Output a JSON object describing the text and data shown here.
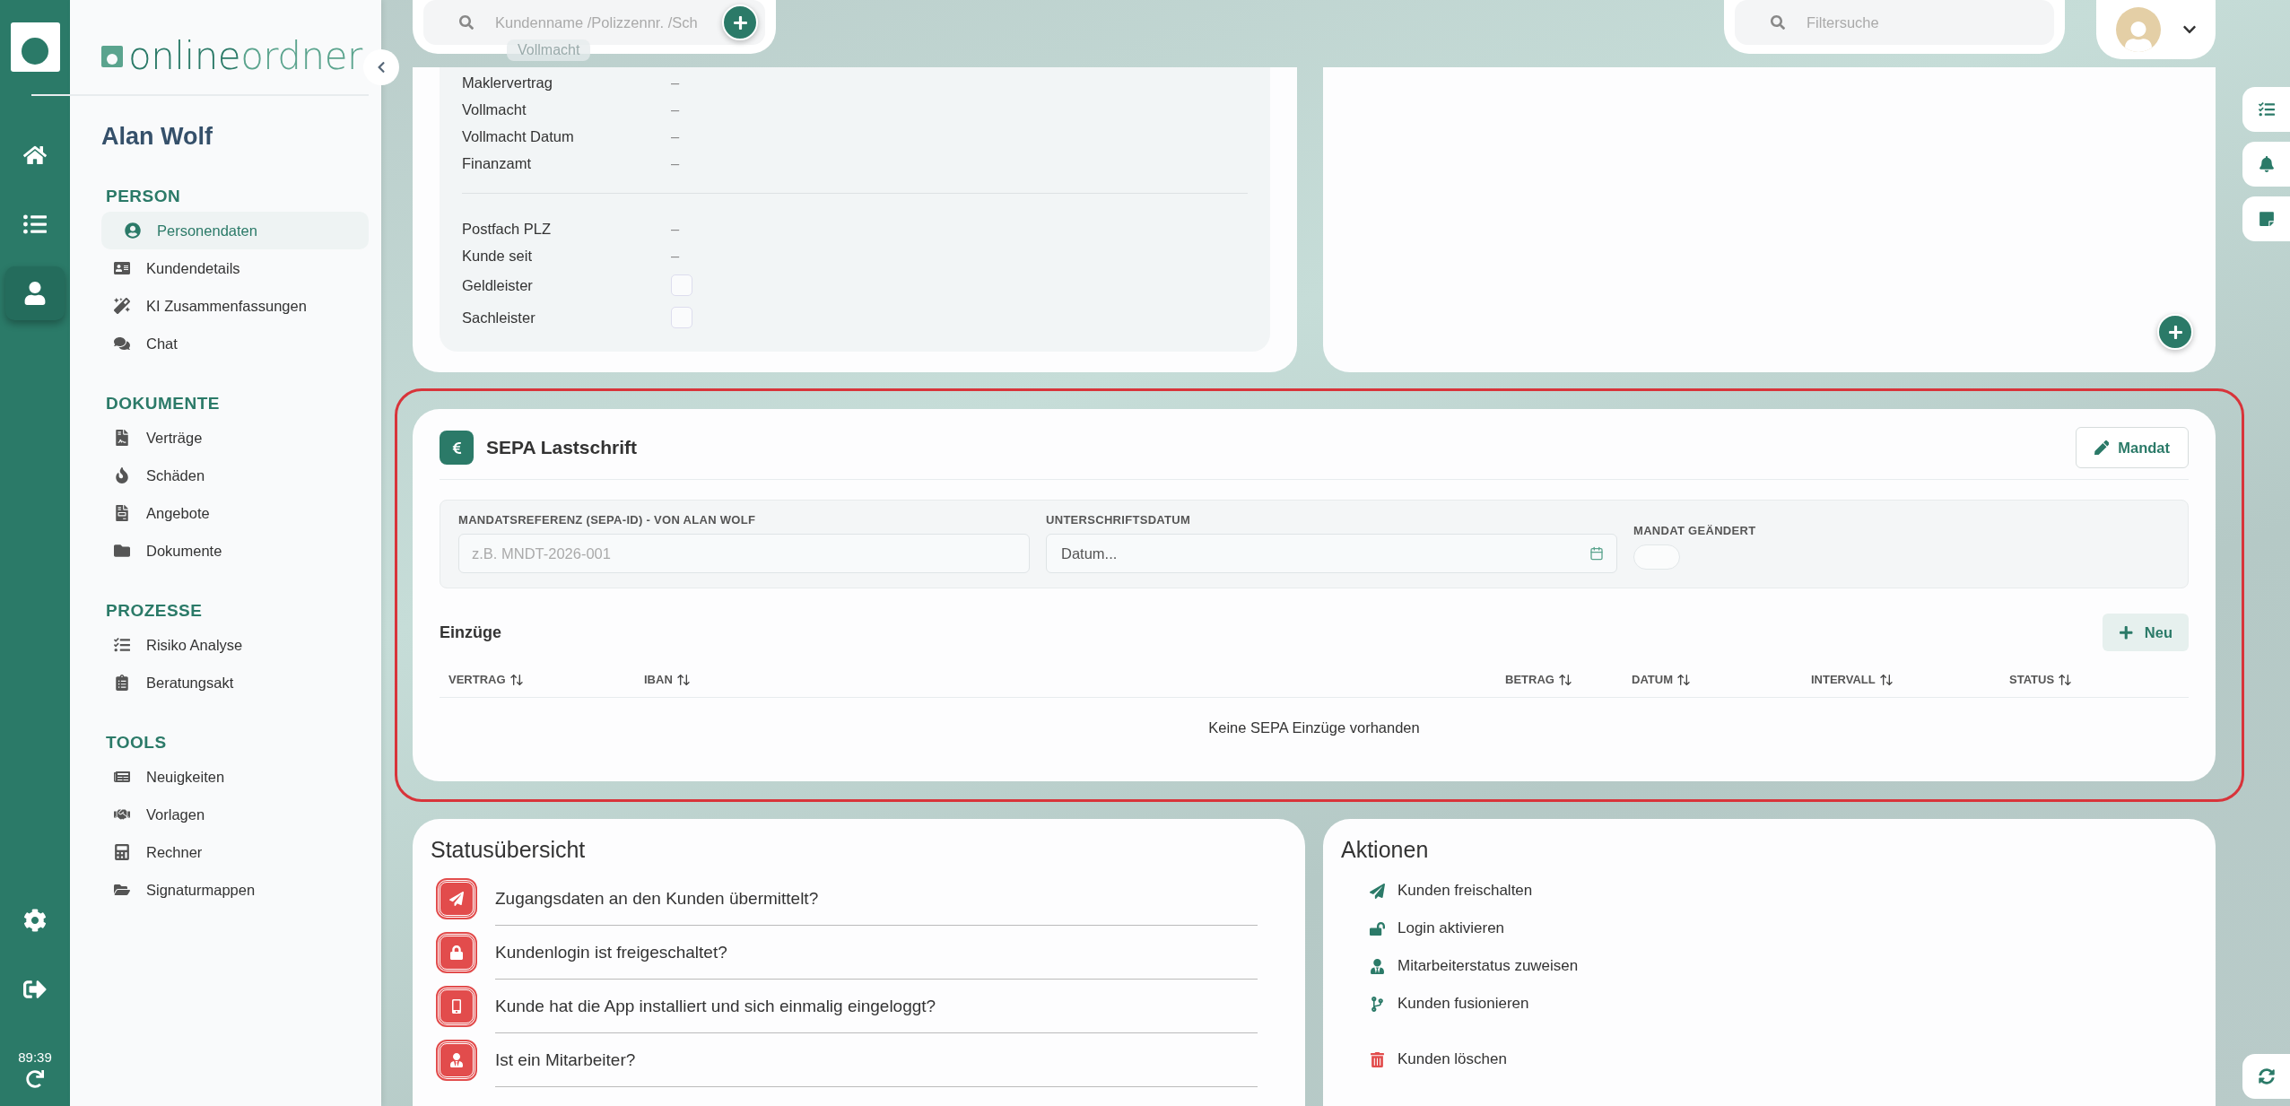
{
  "rail": {
    "top_items": [
      {
        "selected": false
      },
      {
        "selected": false
      },
      {
        "selected": true
      }
    ],
    "bottom_items": [
      {
        "selected": false
      },
      {
        "selected": false
      }
    ],
    "time": "89:39"
  },
  "brand": {
    "part_1": "online",
    "part_2": "ordner"
  },
  "sidebar": {
    "user": "Alan Wolf",
    "sections": [
      {
        "title": "PERSON",
        "items": [
          {
            "label": "Personendaten",
            "selected": true
          },
          {
            "label": "Kundendetails",
            "selected": false
          },
          {
            "label": "KI Zusammenfassungen",
            "selected": false
          },
          {
            "label": "Chat",
            "selected": false
          }
        ]
      },
      {
        "title": "DOKUMENTE",
        "items": [
          {
            "label": "Verträge",
            "selected": false
          },
          {
            "label": "Schäden",
            "selected": false
          },
          {
            "label": "Angebote",
            "selected": false
          },
          {
            "label": "Dokumente",
            "selected": false
          }
        ]
      },
      {
        "title": "PROZESSE",
        "items": [
          {
            "label": "Risiko Analyse",
            "selected": false
          },
          {
            "label": "Beratungsakt",
            "selected": false
          }
        ]
      },
      {
        "title": "TOOLS",
        "items": [
          {
            "label": "Neuigkeiten",
            "selected": false
          },
          {
            "label": "Vorlagen",
            "selected": false
          },
          {
            "label": "Rechner",
            "selected": false
          },
          {
            "label": "Signaturmappen",
            "selected": false
          }
        ]
      }
    ]
  },
  "search": {
    "placeholder": "Kundenname /Polizzennr. /Sch"
  },
  "filter": {
    "placeholder": "Filtersuche"
  },
  "tooltip": "Vollmacht",
  "details": {
    "rows": [
      {
        "label": "Maklervertrag",
        "kind": "text",
        "value": "–"
      },
      {
        "label": "Vollmacht",
        "kind": "text",
        "value": "–"
      },
      {
        "label": "Vollmacht Datum",
        "kind": "text",
        "value": "–"
      },
      {
        "label": "Finanzamt",
        "kind": "text",
        "value": "–"
      }
    ],
    "rows_2": [
      {
        "label": "Postfach PLZ",
        "kind": "text",
        "value": "–"
      },
      {
        "label": "Kunde seit",
        "kind": "text",
        "value": "–"
      },
      {
        "label": "Geldleister",
        "kind": "checkbox",
        "checked": false
      },
      {
        "label": "Sachleister",
        "kind": "checkbox",
        "checked": false
      }
    ]
  },
  "sepa": {
    "highlighted": true,
    "title": "SEPA Lastschrift",
    "edit_button": "Mandat",
    "fields": [
      {
        "label": "MANDATSREFERENZ (SEPA-ID) - VON ALAN WOLF",
        "kind": "text",
        "placeholder": "z.B. MNDT-2026-001"
      },
      {
        "label": "UNTERSCHRIFTSDATUM",
        "kind": "date",
        "placeholder": "Datum..."
      },
      {
        "label": "MANDAT GEÄNDERT",
        "kind": "toggle",
        "on": false
      }
    ],
    "collections": {
      "title": "Einzüge",
      "new_button": "Neu",
      "columns": [
        "VERTRAG",
        "IBAN",
        "BETRAG",
        "DATUM",
        "INTERVALL",
        "STATUS"
      ],
      "empty": "Keine SEPA Einzüge vorhanden"
    }
  },
  "status": {
    "title": "Statusübersicht",
    "items": [
      {
        "label": "Zugangsdaten an den Kunden übermittelt?",
        "done": false
      },
      {
        "label": "Kundenlogin ist freigeschaltet?",
        "done": false
      },
      {
        "label": "Kunde hat die App installiert und sich einmalig eingeloggt?",
        "done": false
      },
      {
        "label": "Ist ein Mitarbeiter?",
        "done": false
      }
    ]
  },
  "actions": {
    "title": "Aktionen",
    "items": [
      {
        "label": "Kunden freischalten",
        "kind": "normal"
      },
      {
        "label": "Login aktivieren",
        "kind": "normal"
      },
      {
        "label": "Mitarbeiterstatus zuweisen",
        "kind": "normal"
      },
      {
        "label": "Kunden fusionieren",
        "kind": "normal"
      },
      {
        "label": "Kunden löschen",
        "kind": "danger"
      }
    ]
  }
}
